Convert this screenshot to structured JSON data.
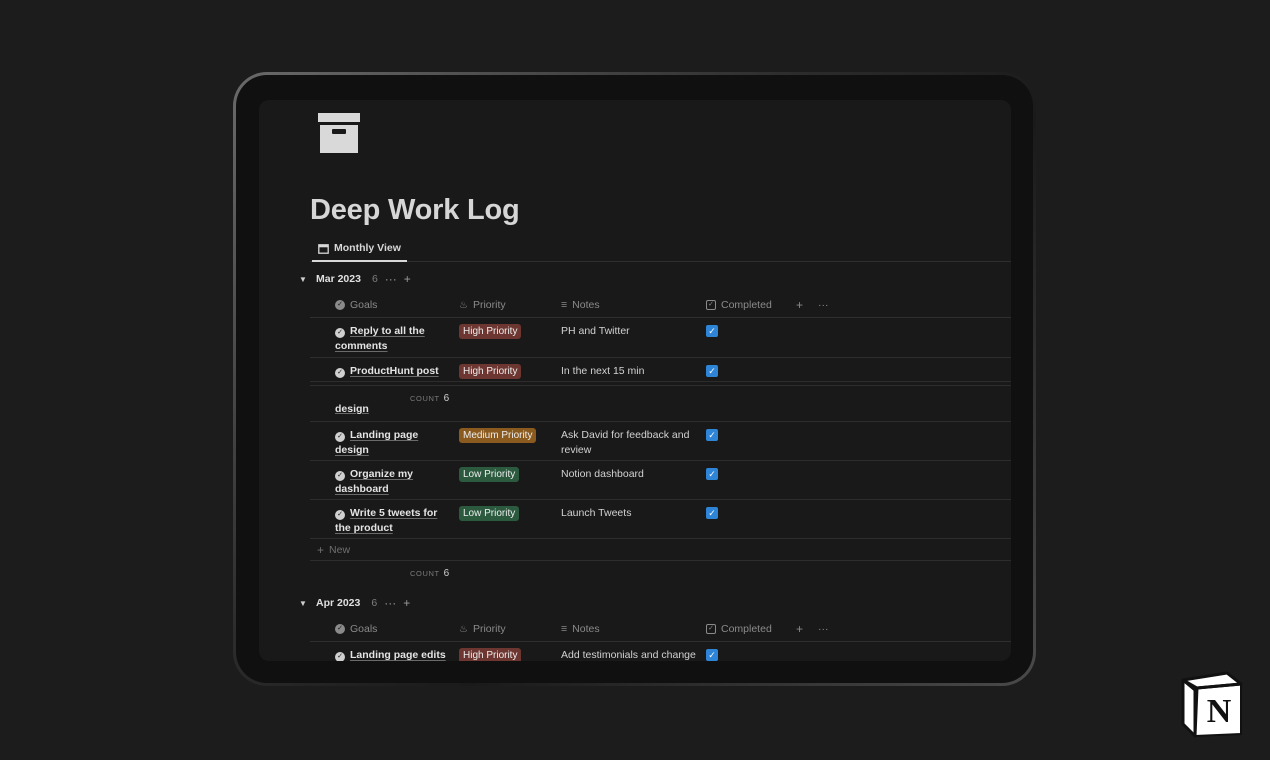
{
  "page": {
    "title": "Deep Work Log",
    "page_icon": "archive-box-icon"
  },
  "tabs": [
    {
      "label": "Monthly View",
      "icon": "calendar-icon",
      "active": true
    }
  ],
  "columns": {
    "goals": "Goals",
    "priority": "Priority",
    "notes": "Notes",
    "completed": "Completed"
  },
  "groups": [
    {
      "name": "Mar 2023",
      "count": "6",
      "rows": [
        {
          "goal": "Reply to all the comments",
          "priority": "High Priority",
          "priority_level": "high",
          "notes": "PH and Twitter",
          "completed": true
        },
        {
          "goal": "ProductHunt post",
          "priority": "High Priority",
          "priority_level": "high",
          "notes": "In the next 15 min",
          "completed": true
        },
        {
          "goal": "design",
          "clipped": true
        },
        {
          "goal": "Landing page design",
          "priority": "Medium Priority",
          "priority_level": "medium",
          "notes": "Ask David for feedback and review",
          "completed": true
        },
        {
          "goal": "Organize my dashboard",
          "priority": "Low Priority",
          "priority_level": "low",
          "notes": "Notion dashboard",
          "completed": true
        },
        {
          "goal": "Write 5 tweets for the product",
          "priority": "Low Priority",
          "priority_level": "low",
          "notes": "Launch Tweets",
          "completed": true
        }
      ],
      "sticky_count_label": "COUNT",
      "sticky_count_value": "6",
      "new_label": "New",
      "footer_count_label": "COUNT",
      "footer_count_value": "6"
    },
    {
      "name": "Apr 2023",
      "count": "6",
      "rows": [
        {
          "goal": "Landing page edits",
          "priority": "High Priority",
          "priority_level": "high",
          "notes": "Add testimonials and change",
          "completed": true
        }
      ]
    }
  ],
  "colors": {
    "background": "#1c1c1c",
    "screen": "#191919",
    "high_priority": "#6e3630",
    "medium_priority": "#8a5a1e",
    "low_priority": "#2b5a3f",
    "checkbox": "#2e84d6"
  },
  "brand": {
    "logo": "notion-logo-icon",
    "letter": "N"
  }
}
